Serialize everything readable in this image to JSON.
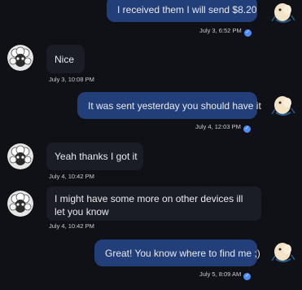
{
  "messages": [
    {
      "direction": "outgoing",
      "text": "I received them I will send $8.20",
      "time": "July 3, 6:52 PM"
    },
    {
      "direction": "incoming",
      "text": "Nice",
      "time": "July 3, 10:08 PM"
    },
    {
      "direction": "outgoing",
      "text": "It was sent yesterday you should have it",
      "time": "July 4, 12:03 PM"
    },
    {
      "direction": "incoming",
      "text": "Yeah thanks I got it",
      "time": "July 4, 10:42 PM"
    },
    {
      "direction": "incoming",
      "text": "I might have some more on other devices ill let you know",
      "time": "July 4, 10:42 PM"
    },
    {
      "direction": "outgoing",
      "text": "Great! You know where to find me ;)",
      "time": "July 5, 8:09 AM"
    }
  ],
  "icons": {
    "incoming_avatar": "sheep-avatar-icon",
    "outgoing_avatar": "cartoon-sticker-avatar-icon",
    "read_receipt": "check-circle-icon"
  },
  "colors": {
    "background": "#101116",
    "incoming_bubble": "#1b1d26",
    "outgoing_bubble": "#223f7a",
    "read_receipt": "#4c8dff"
  }
}
